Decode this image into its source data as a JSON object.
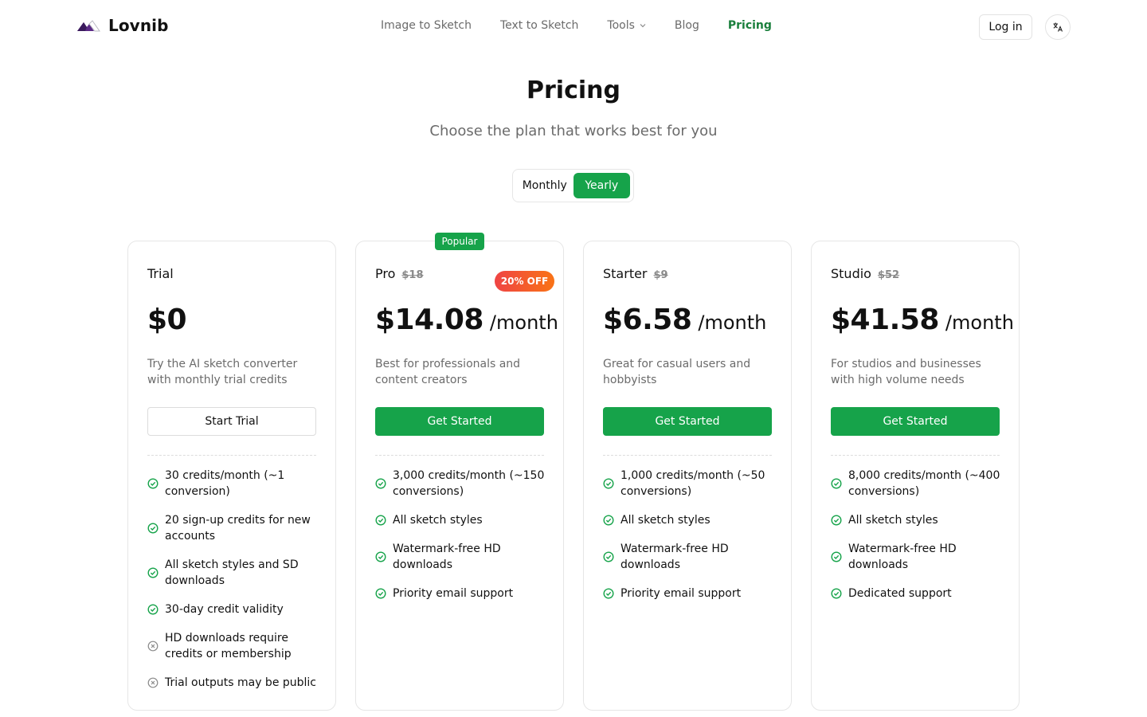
{
  "brand": {
    "name": "Lovnib",
    "logo_icon": "mountain-logo-icon",
    "accent_color": "#16a34a",
    "logo_color": "#5b2a86"
  },
  "nav": {
    "items": [
      {
        "label": "Image to Sketch"
      },
      {
        "label": "Text to Sketch"
      },
      {
        "label": "Tools",
        "icon": "chevron-down-icon"
      },
      {
        "label": "Blog"
      },
      {
        "label": "Pricing",
        "active": true
      }
    ],
    "login_label": "Log in",
    "language_icon": "translate-icon"
  },
  "hero": {
    "title": "Pricing",
    "subtitle": "Choose the plan that works best for you"
  },
  "billing_toggle": {
    "monthly_label": "Monthly",
    "yearly_label": "Yearly",
    "selected": "Yearly"
  },
  "plans": [
    {
      "name": "Trial",
      "old_price": "",
      "price": "$0",
      "per": "",
      "description": "Try the AI sketch converter with monthly trial credits",
      "cta": "Start Trial",
      "features": [
        {
          "text": "30 credits/month (~1 conversion)",
          "icon": "check-circle-icon"
        },
        {
          "text": "20 sign-up credits for new accounts",
          "icon": "check-circle-icon"
        },
        {
          "text": "All sketch styles and SD downloads",
          "icon": "check-circle-icon"
        },
        {
          "text": "30-day credit validity",
          "icon": "check-circle-icon"
        },
        {
          "text": "HD downloads require credits or membership",
          "icon": "x-circle-icon"
        },
        {
          "text": "Trial outputs may be public",
          "icon": "x-circle-icon"
        }
      ]
    },
    {
      "name": "Pro",
      "old_price": "$18",
      "price": "$14.08",
      "per": "/month",
      "badge": "Popular",
      "discount": "20% OFF",
      "description": "Best for professionals and content creators",
      "cta": "Get Started",
      "features": [
        {
          "text": "3,000 credits/month (~150 conversions)",
          "icon": "check-circle-icon"
        },
        {
          "text": "All sketch styles",
          "icon": "check-circle-icon"
        },
        {
          "text": "Watermark-free HD downloads",
          "icon": "check-circle-icon"
        },
        {
          "text": "Priority email support",
          "icon": "check-circle-icon"
        }
      ]
    },
    {
      "name": "Starter",
      "old_price": "$9",
      "price": "$6.58",
      "per": "/month",
      "description": "Great for casual users and hobbyists",
      "cta": "Get Started",
      "features": [
        {
          "text": "1,000 credits/month (~50 conversions)",
          "icon": "check-circle-icon"
        },
        {
          "text": "All sketch styles",
          "icon": "check-circle-icon"
        },
        {
          "text": "Watermark-free HD downloads",
          "icon": "check-circle-icon"
        },
        {
          "text": "Priority email support",
          "icon": "check-circle-icon"
        }
      ]
    },
    {
      "name": "Studio",
      "old_price": "$52",
      "price": "$41.58",
      "per": "/month",
      "description": "For studios and businesses with high volume needs",
      "cta": "Get Started",
      "features": [
        {
          "text": "8,000 credits/month (~400 conversions)",
          "icon": "check-circle-icon"
        },
        {
          "text": "All sketch styles",
          "icon": "check-circle-icon"
        },
        {
          "text": "Watermark-free HD downloads",
          "icon": "check-circle-icon"
        },
        {
          "text": "Dedicated support",
          "icon": "check-circle-icon"
        }
      ]
    }
  ]
}
